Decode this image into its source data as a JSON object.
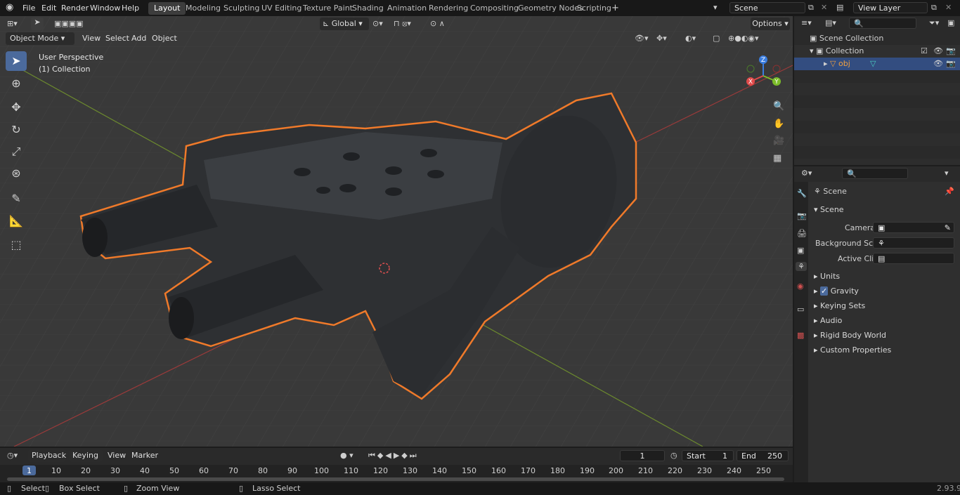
{
  "menus": [
    "File",
    "Edit",
    "Render",
    "Window",
    "Help"
  ],
  "workspaces": [
    "Layout",
    "Modeling",
    "Sculpting",
    "UV Editing",
    "Texture Paint",
    "Shading",
    "Animation",
    "Rendering",
    "Compositing",
    "Geometry Nodes",
    "Scripting"
  ],
  "scene_field": "Scene",
  "view_layer_field": "View Layer",
  "viewport": {
    "mode": "Object Mode",
    "menu_view": "View",
    "menu_select": "Select",
    "menu_add": "Add",
    "menu_object": "Object",
    "transform": "Global",
    "options": "Options",
    "perspective": "User Perspective",
    "collection": "(1) Collection",
    "gizmo": {
      "z": "Z",
      "y": "Y",
      "x": "X"
    }
  },
  "outliner": {
    "scene_collection": "Scene Collection",
    "collection": "Collection",
    "object": "obj"
  },
  "properties": {
    "title": "Scene",
    "section": "Scene",
    "camera_label": "Camera",
    "background_label": "Background Scene",
    "clip_label": "Active Clip",
    "panels": [
      "Units",
      "Gravity",
      "Keying Sets",
      "Audio",
      "Rigid Body World",
      "Custom Properties"
    ]
  },
  "timeline": {
    "playback": "Playback",
    "keying": "Keying",
    "view": "View",
    "marker": "Marker",
    "current_frame": "1",
    "start_label": "Start",
    "start": "1",
    "end_label": "End",
    "end": "250",
    "ruler": [
      "1",
      "10",
      "20",
      "30",
      "40",
      "50",
      "60",
      "70",
      "80",
      "90",
      "100",
      "110",
      "120",
      "130",
      "140",
      "150",
      "160",
      "170",
      "180",
      "190",
      "200",
      "210",
      "220",
      "230",
      "240",
      "250"
    ]
  },
  "status": {
    "select": "Select",
    "box_select": "Box Select",
    "zoom": "Zoom View",
    "lasso": "Lasso Select",
    "version": "2.93.9"
  },
  "colors": {
    "accent": "#4b6a9c",
    "selection": "#f07a2a",
    "grid": "#444444"
  }
}
